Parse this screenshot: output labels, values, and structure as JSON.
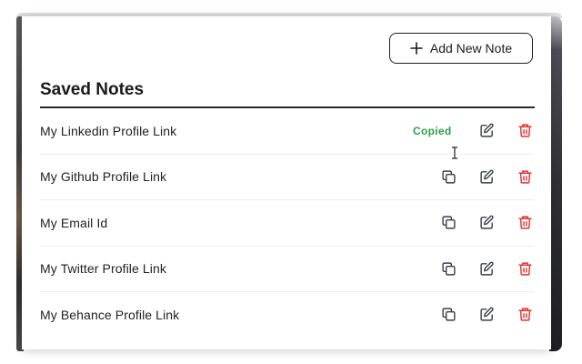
{
  "header": {
    "add_button_label": "Add New Note",
    "add_icon": "plus-icon"
  },
  "title": "Saved Notes",
  "notes": [
    {
      "name": "My Linkedin Profile Link",
      "status": "Copied"
    },
    {
      "name": "My Github Profile Link"
    },
    {
      "name": "My Email Id"
    },
    {
      "name": "My Twitter Profile Link"
    },
    {
      "name": "My Behance Profile Link"
    }
  ],
  "icons": {
    "copy": "copy-icon",
    "edit": "edit-icon",
    "delete": "trash-icon"
  },
  "colors": {
    "copied": "#2ea04a",
    "delete": "#e0322f",
    "icon": "#3a3f4a"
  }
}
